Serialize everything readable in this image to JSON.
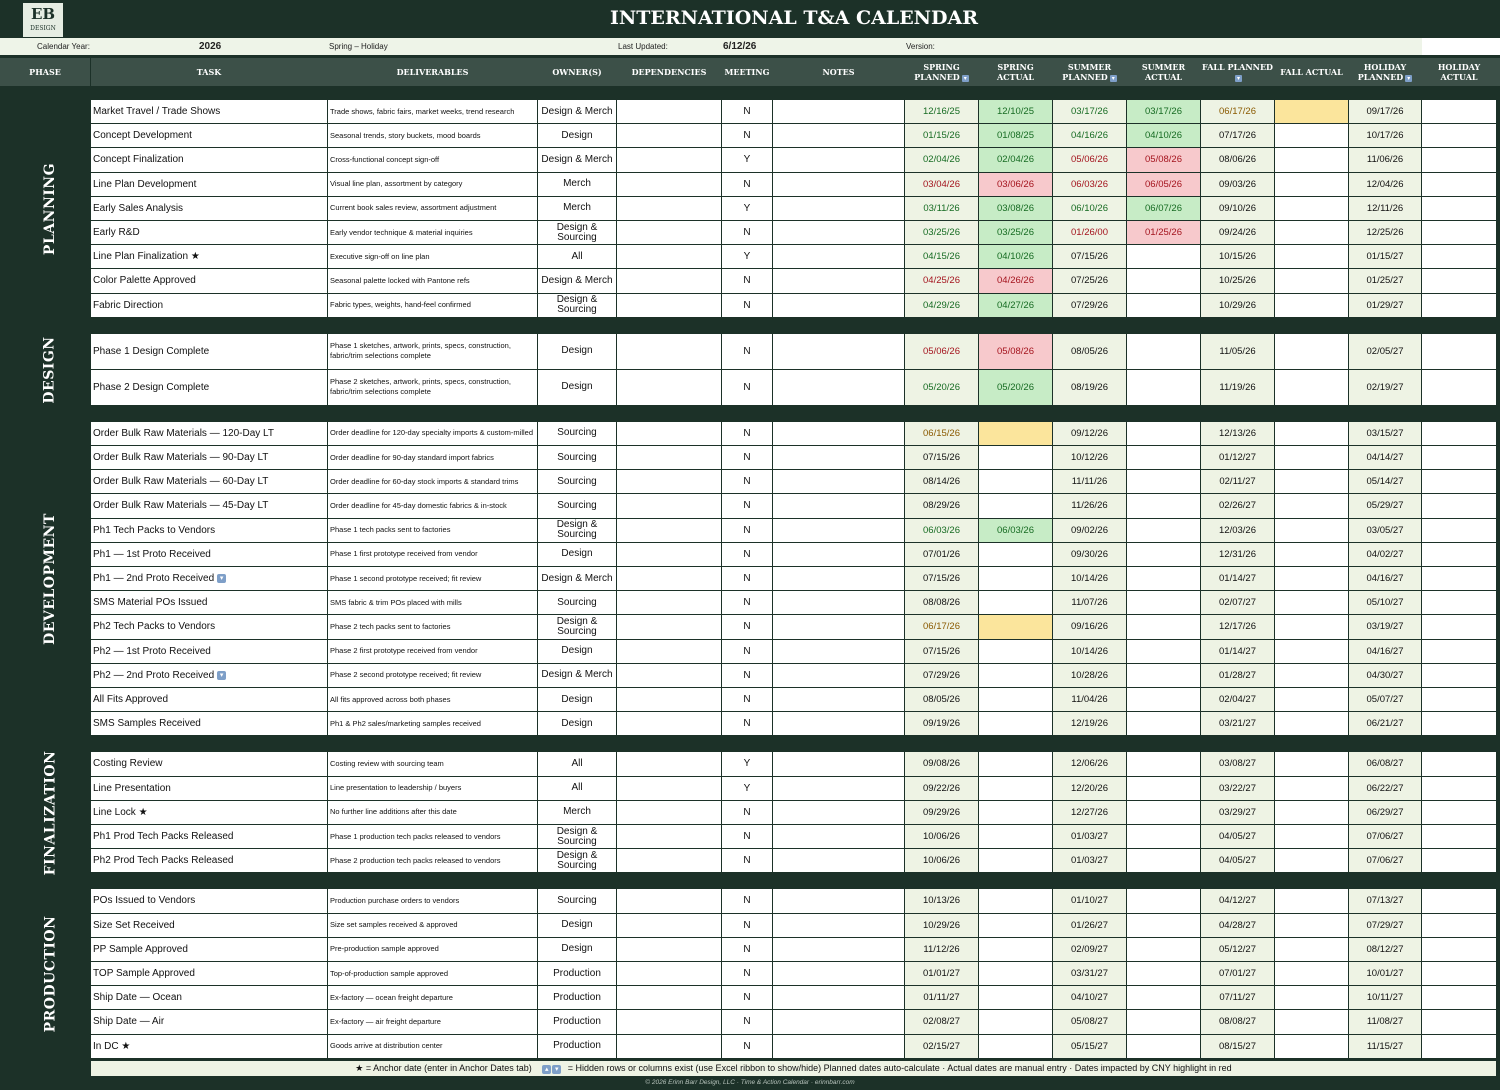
{
  "title": "INTERNATIONAL T&A CALENDAR",
  "logo": {
    "mark": "EB",
    "sub": "DESIGN"
  },
  "info": {
    "year_label": "Calendar Year:",
    "year": "2026",
    "season": "Spring – Holiday",
    "updated_label": "Last Updated:",
    "updated": "6/12/26",
    "version_label": "Version:"
  },
  "columns": {
    "phase": "PHASE",
    "task": "TASK",
    "deliverables": "DELIVERABLES",
    "owners": "OWNER(S)",
    "dependencies": "DEPENDENCIES",
    "meeting": "MEETING",
    "notes": "NOTES",
    "spring_planned": "SPRING PLANNED",
    "spring_actual": "SPRING ACTUAL",
    "summer_planned": "SUMMER PLANNED",
    "summer_actual": "SUMMER ACTUAL",
    "fall_planned": "FALL PLANNED",
    "fall_actual": "FALL ACTUAL",
    "holiday_planned": "HOLIDAY PLANNED",
    "holiday_actual": "HOLIDAY ACTUAL"
  },
  "colors": {
    "green": "#c7ecc6",
    "red": "#f7c9cc",
    "yellow": "#fbe59c",
    "planned": "#eef3e4",
    "dark": "#1c3128",
    "header": "#3c5048"
  },
  "icons": {
    "hidden_rows": "hidden-rows-icon",
    "star": "star-icon"
  },
  "phases": [
    {
      "name": "PLANNING",
      "rows": [
        {
          "task": "Market Travel / Trade Shows",
          "del": "Trade shows, fabric fairs, market weeks, trend research",
          "owner": "Design & Merch",
          "meet": "N",
          "sp": "12/16/25",
          "sa": "12/10/25",
          "sup": "03/17/26",
          "sua": "03/17/26",
          "fp": "06/17/26",
          "fa": "",
          "hp": "09/17/26",
          "ha": "",
          "st": {
            "sp": "g",
            "sa": "g",
            "sup": "g",
            "sua": "g",
            "fp": "y",
            "fa": "y"
          }
        },
        {
          "task": "Concept Development",
          "del": "Seasonal trends, story buckets, mood boards",
          "owner": "Design",
          "meet": "N",
          "sp": "01/15/26",
          "sa": "01/08/25",
          "sup": "04/16/26",
          "sua": "04/10/26",
          "fp": "07/17/26",
          "fa": "",
          "hp": "10/17/26",
          "ha": "",
          "st": {
            "sp": "g",
            "sa": "g",
            "sup": "g",
            "sua": "g"
          }
        },
        {
          "task": "Concept Finalization",
          "del": "Cross-functional concept sign-off",
          "owner": "Design & Merch",
          "meet": "Y",
          "sp": "02/04/26",
          "sa": "02/04/26",
          "sup": "05/06/26",
          "sua": "05/08/26",
          "fp": "08/06/26",
          "fa": "",
          "hp": "11/06/26",
          "ha": "",
          "st": {
            "sp": "g",
            "sa": "g",
            "sup": "r",
            "sua": "r"
          }
        },
        {
          "task": "Line Plan Development",
          "del": "Visual line plan, assortment by category",
          "owner": "Merch",
          "meet": "N",
          "sp": "03/04/26",
          "sa": "03/06/26",
          "sup": "06/03/26",
          "sua": "06/05/26",
          "fp": "09/03/26",
          "fa": "",
          "hp": "12/04/26",
          "ha": "",
          "st": {
            "sp": "r",
            "sa": "r",
            "sup": "r",
            "sua": "r"
          }
        },
        {
          "task": "Early Sales Analysis",
          "del": "Current book sales review, assortment adjustment",
          "owner": "Merch",
          "meet": "Y",
          "sp": "03/11/26",
          "sa": "03/08/26",
          "sup": "06/10/26",
          "sua": "06/07/26",
          "fp": "09/10/26",
          "fa": "",
          "hp": "12/11/26",
          "ha": "",
          "st": {
            "sp": "g",
            "sa": "g",
            "sup": "g",
            "sua": "g"
          }
        },
        {
          "task": "Early R&D",
          "del": "Early vendor technique & material inquiries",
          "owner": "Design & Sourcing",
          "meet": "N",
          "sp": "03/25/26",
          "sa": "03/25/26",
          "sup": "01/26/00",
          "sua": "01/25/26",
          "fp": "09/24/26",
          "fa": "",
          "hp": "12/25/26",
          "ha": "",
          "st": {
            "sp": "g",
            "sa": "g",
            "sup": "r",
            "sua": "r"
          }
        },
        {
          "task": "Line Plan Finalization ★",
          "del": "Executive sign-off on line plan",
          "owner": "All",
          "meet": "Y",
          "sp": "04/15/26",
          "sa": "04/10/26",
          "sup": "07/15/26",
          "sua": "",
          "fp": "10/15/26",
          "fa": "",
          "hp": "01/15/27",
          "ha": "",
          "st": {
            "sp": "g",
            "sa": "g"
          }
        },
        {
          "task": "Color Palette Approved",
          "del": "Seasonal palette locked with Pantone refs",
          "owner": "Design & Merch",
          "meet": "N",
          "sp": "04/25/26",
          "sa": "04/26/26",
          "sup": "07/25/26",
          "sua": "",
          "fp": "10/25/26",
          "fa": "",
          "hp": "01/25/27",
          "ha": "",
          "st": {
            "sp": "r",
            "sa": "r"
          }
        },
        {
          "task": "Fabric Direction",
          "del": "Fabric types, weights, hand-feel confirmed",
          "owner": "Design & Sourcing",
          "meet": "N",
          "sp": "04/29/26",
          "sa": "04/27/26",
          "sup": "07/29/26",
          "sua": "",
          "fp": "10/29/26",
          "fa": "",
          "hp": "01/29/27",
          "ha": "",
          "st": {
            "sp": "g",
            "sa": "g"
          }
        }
      ]
    },
    {
      "name": "DESIGN",
      "rows": [
        {
          "task": "Phase 1 Design Complete",
          "del": "Phase 1 sketches, artwork, prints, specs, construction, fabric/trim selections complete",
          "owner": "Design",
          "meet": "N",
          "sp": "05/06/26",
          "sa": "05/08/26",
          "sup": "08/05/26",
          "sua": "",
          "fp": "11/05/26",
          "fa": "",
          "hp": "02/05/27",
          "ha": "",
          "st": {
            "sp": "r",
            "sa": "r"
          }
        },
        {
          "task": "Phase 2 Design Complete",
          "del": "Phase 2 sketches, artwork, prints, specs, construction, fabric/trim selections complete",
          "owner": "Design",
          "meet": "N",
          "sp": "05/20/26",
          "sa": "05/20/26",
          "sup": "08/19/26",
          "sua": "",
          "fp": "11/19/26",
          "fa": "",
          "hp": "02/19/27",
          "ha": "",
          "st": {
            "sp": "g",
            "sa": "g"
          }
        }
      ]
    },
    {
      "name": "DEVELOPMENT",
      "rows": [
        {
          "task": "Order Bulk Raw Materials — 120-Day LT",
          "del": "Order deadline for 120-day specialty imports & custom-milled",
          "owner": "Sourcing",
          "meet": "N",
          "sp": "06/15/26",
          "sa": "",
          "sup": "09/12/26",
          "sua": "",
          "fp": "12/13/26",
          "fa": "",
          "hp": "03/15/27",
          "ha": "",
          "st": {
            "sp": "y",
            "sa": "y"
          }
        },
        {
          "task": "Order Bulk Raw Materials — 90-Day LT",
          "del": "Order deadline for 90-day standard import fabrics",
          "owner": "Sourcing",
          "meet": "N",
          "sp": "07/15/26",
          "sa": "",
          "sup": "10/12/26",
          "sua": "",
          "fp": "01/12/27",
          "fa": "",
          "hp": "04/14/27",
          "ha": "",
          "st": {}
        },
        {
          "task": "Order Bulk Raw Materials — 60-Day LT",
          "del": "Order deadline for 60-day stock imports & standard trims",
          "owner": "Sourcing",
          "meet": "N",
          "sp": "08/14/26",
          "sa": "",
          "sup": "11/11/26",
          "sua": "",
          "fp": "02/11/27",
          "fa": "",
          "hp": "05/14/27",
          "ha": "",
          "st": {}
        },
        {
          "task": "Order Bulk Raw Materials — 45-Day LT",
          "del": "Order deadline for 45-day domestic fabrics & in-stock",
          "owner": "Sourcing",
          "meet": "N",
          "sp": "08/29/26",
          "sa": "",
          "sup": "11/26/26",
          "sua": "",
          "fp": "02/26/27",
          "fa": "",
          "hp": "05/29/27",
          "ha": "",
          "st": {}
        },
        {
          "task": "Ph1 Tech Packs to Vendors",
          "del": "Phase 1 tech packs sent to factories",
          "owner": "Design & Sourcing",
          "meet": "N",
          "sp": "06/03/26",
          "sa": "06/03/26",
          "sup": "09/02/26",
          "sua": "",
          "fp": "12/03/26",
          "fa": "",
          "hp": "03/05/27",
          "ha": "",
          "st": {
            "sp": "g",
            "sa": "g"
          }
        },
        {
          "task": "Ph1 — 1st Proto Received",
          "del": "Phase 1 first prototype received from vendor",
          "owner": "Design",
          "meet": "N",
          "sp": "07/01/26",
          "sa": "",
          "sup": "09/30/26",
          "sua": "",
          "fp": "12/31/26",
          "fa": "",
          "hp": "04/02/27",
          "ha": "",
          "st": {}
        },
        {
          "task": "Ph1 — 2nd Proto Received",
          "hid": true,
          "del": "Phase 1 second prototype received; fit review",
          "owner": "Design & Merch",
          "meet": "N",
          "sp": "07/15/26",
          "sa": "",
          "sup": "10/14/26",
          "sua": "",
          "fp": "01/14/27",
          "fa": "",
          "hp": "04/16/27",
          "ha": "",
          "st": {}
        },
        {
          "task": "SMS Material POs Issued",
          "del": "SMS fabric & trim POs placed with mills",
          "owner": "Sourcing",
          "meet": "N",
          "sp": "08/08/26",
          "sa": "",
          "sup": "11/07/26",
          "sua": "",
          "fp": "02/07/27",
          "fa": "",
          "hp": "05/10/27",
          "ha": "",
          "st": {}
        },
        {
          "task": "Ph2 Tech Packs to Vendors",
          "del": "Phase 2 tech packs sent to factories",
          "owner": "Design & Sourcing",
          "meet": "N",
          "sp": "06/17/26",
          "sa": "",
          "sup": "09/16/26",
          "sua": "",
          "fp": "12/17/26",
          "fa": "",
          "hp": "03/19/27",
          "ha": "",
          "st": {
            "sp": "y",
            "sa": "y"
          }
        },
        {
          "task": "Ph2 — 1st Proto Received",
          "del": "Phase 2 first prototype received from vendor",
          "owner": "Design",
          "meet": "N",
          "sp": "07/15/26",
          "sa": "",
          "sup": "10/14/26",
          "sua": "",
          "fp": "01/14/27",
          "fa": "",
          "hp": "04/16/27",
          "ha": "",
          "st": {}
        },
        {
          "task": "Ph2 — 2nd Proto Received",
          "hid": true,
          "del": "Phase 2 second prototype received; fit review",
          "owner": "Design & Merch",
          "meet": "N",
          "sp": "07/29/26",
          "sa": "",
          "sup": "10/28/26",
          "sua": "",
          "fp": "01/28/27",
          "fa": "",
          "hp": "04/30/27",
          "ha": "",
          "st": {}
        },
        {
          "task": "All Fits Approved",
          "del": "All fits approved across both phases",
          "owner": "Design",
          "meet": "N",
          "sp": "08/05/26",
          "sa": "",
          "sup": "11/04/26",
          "sua": "",
          "fp": "02/04/27",
          "fa": "",
          "hp": "05/07/27",
          "ha": "",
          "st": {}
        },
        {
          "task": "SMS Samples Received",
          "del": "Ph1 & Ph2 sales/marketing samples received",
          "owner": "Design",
          "meet": "N",
          "sp": "09/19/26",
          "sa": "",
          "sup": "12/19/26",
          "sua": "",
          "fp": "03/21/27",
          "fa": "",
          "hp": "06/21/27",
          "ha": "",
          "st": {}
        }
      ]
    },
    {
      "name": "FINALIZATION",
      "rows": [
        {
          "task": "Costing Review",
          "del": "Costing review with sourcing team",
          "owner": "All",
          "meet": "Y",
          "sp": "09/08/26",
          "sa": "",
          "sup": "12/06/26",
          "sua": "",
          "fp": "03/08/27",
          "fa": "",
          "hp": "06/08/27",
          "ha": "",
          "st": {}
        },
        {
          "task": "Line Presentation",
          "del": "Line presentation to leadership / buyers",
          "owner": "All",
          "meet": "Y",
          "sp": "09/22/26",
          "sa": "",
          "sup": "12/20/26",
          "sua": "",
          "fp": "03/22/27",
          "fa": "",
          "hp": "06/22/27",
          "ha": "",
          "st": {}
        },
        {
          "task": "Line Lock ★",
          "del": "No further line additions after this date",
          "owner": "Merch",
          "meet": "N",
          "sp": "09/29/26",
          "sa": "",
          "sup": "12/27/26",
          "sua": "",
          "fp": "03/29/27",
          "fa": "",
          "hp": "06/29/27",
          "ha": "",
          "st": {}
        },
        {
          "task": "Ph1 Prod Tech Packs Released",
          "del": "Phase 1 production tech packs released to vendors",
          "owner": "Design & Sourcing",
          "meet": "N",
          "sp": "10/06/26",
          "sa": "",
          "sup": "01/03/27",
          "sua": "",
          "fp": "04/05/27",
          "fa": "",
          "hp": "07/06/27",
          "ha": "",
          "st": {}
        },
        {
          "task": "Ph2 Prod Tech Packs Released",
          "del": "Phase 2 production tech packs released to vendors",
          "owner": "Design & Sourcing",
          "meet": "N",
          "sp": "10/06/26",
          "sa": "",
          "sup": "01/03/27",
          "sua": "",
          "fp": "04/05/27",
          "fa": "",
          "hp": "07/06/27",
          "ha": "",
          "st": {}
        }
      ]
    },
    {
      "name": "PRODUCTION",
      "rows": [
        {
          "task": "POs Issued to Vendors",
          "del": "Production purchase orders to vendors",
          "owner": "Sourcing",
          "meet": "N",
          "sp": "10/13/26",
          "sa": "",
          "sup": "01/10/27",
          "sua": "",
          "fp": "04/12/27",
          "fa": "",
          "hp": "07/13/27",
          "ha": "",
          "st": {}
        },
        {
          "task": "Size Set Received",
          "del": "Size set samples received & approved",
          "owner": "Design",
          "meet": "N",
          "sp": "10/29/26",
          "sa": "",
          "sup": "01/26/27",
          "sua": "",
          "fp": "04/28/27",
          "fa": "",
          "hp": "07/29/27",
          "ha": "",
          "st": {}
        },
        {
          "task": "PP Sample Approved",
          "del": "Pre-production sample approved",
          "owner": "Design",
          "meet": "N",
          "sp": "11/12/26",
          "sa": "",
          "sup": "02/09/27",
          "sua": "",
          "fp": "05/12/27",
          "fa": "",
          "hp": "08/12/27",
          "ha": "",
          "st": {}
        },
        {
          "task": "TOP Sample Approved",
          "del": "Top-of-production sample approved",
          "owner": "Production",
          "meet": "N",
          "sp": "01/01/27",
          "sa": "",
          "sup": "03/31/27",
          "sua": "",
          "fp": "07/01/27",
          "fa": "",
          "hp": "10/01/27",
          "ha": "",
          "st": {}
        },
        {
          "task": "Ship Date — Ocean",
          "del": "Ex-factory — ocean freight departure",
          "owner": "Production",
          "meet": "N",
          "sp": "01/11/27",
          "sa": "",
          "sup": "04/10/27",
          "sua": "",
          "fp": "07/11/27",
          "fa": "",
          "hp": "10/11/27",
          "ha": "",
          "st": {}
        },
        {
          "task": "Ship Date — Air",
          "del": "Ex-factory — air freight departure",
          "owner": "Production",
          "meet": "N",
          "sp": "02/08/27",
          "sa": "",
          "sup": "05/08/27",
          "sua": "",
          "fp": "08/08/27",
          "fa": "",
          "hp": "11/08/27",
          "ha": "",
          "st": {}
        },
        {
          "task": "In DC ★",
          "del": "Goods arrive at distribution center",
          "owner": "Production",
          "meet": "N",
          "sp": "02/15/27",
          "sa": "",
          "sup": "05/15/27",
          "sua": "",
          "fp": "08/15/27",
          "fa": "",
          "hp": "11/15/27",
          "ha": "",
          "st": {}
        }
      ]
    }
  ],
  "legend": {
    "star_text": "★ = Anchor date (enter in Anchor Dates tab)",
    "hidden_text": "= Hidden rows or columns exist (use Excel ribbon to show/hide)   Planned dates auto-calculate · Actual dates are manual entry · Dates impacted by CNY highlight in red"
  },
  "copyright": "© 2026 Erinn Barr Design, LLC  ·  Time & Action Calendar  ·  erinnbarr.com"
}
